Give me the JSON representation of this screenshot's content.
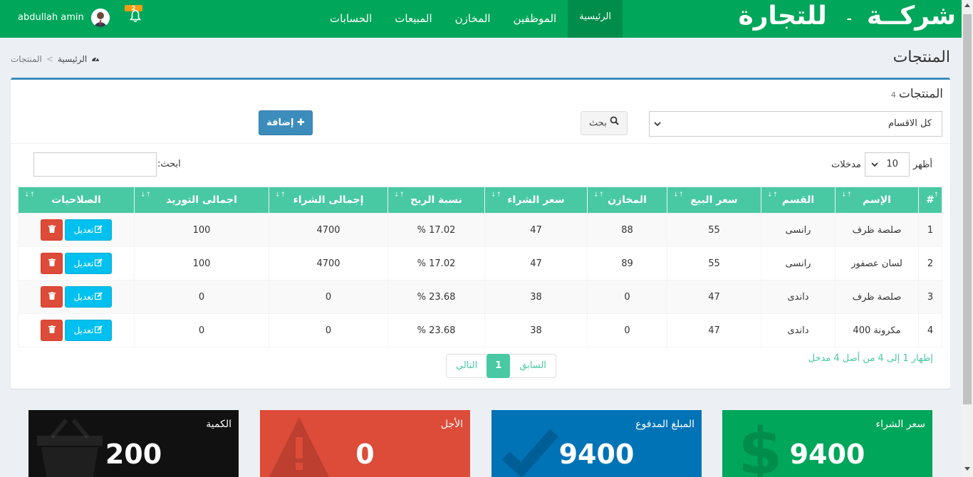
{
  "brand": {
    "name": "شركــة",
    "dash": "ـ",
    "suffix": "للتجارة"
  },
  "nav": {
    "home": "الرئيسية",
    "employees": "الموظفين",
    "stores": "المخازن",
    "sales": "المبيعات",
    "accounts": "الحسابات"
  },
  "user": {
    "name": "abdullah amin",
    "notifications": "2"
  },
  "page": {
    "title": "المنتجات"
  },
  "breadcrumb": {
    "home": "الرئيسية",
    "separator": ">",
    "current": "المنتجات"
  },
  "box": {
    "title": "المنتجات",
    "count": "4"
  },
  "filters": {
    "category_selected": "كل الاقسام",
    "search_button": "بحث",
    "add_button": "إضافة"
  },
  "table_ctrl": {
    "show": "أظهر",
    "length": "10",
    "entries": "مدخلات",
    "search_label": "ابحث:"
  },
  "columns": [
    "#",
    "الإسم",
    "القسم",
    "سعر البيع",
    "المخازن",
    "سعر الشراء",
    "نسبة الربح",
    "إجمالى الشراء",
    "اجمالى التوريد",
    "الصلاحيات"
  ],
  "rows": [
    {
      "num": "1",
      "name": "صلصة ظرف",
      "category": "رانسى",
      "sell": "55",
      "stores": "88",
      "buy": "47",
      "profit": "17.02 %",
      "total_buy": "4700",
      "total_supply": "100"
    },
    {
      "num": "2",
      "name": "لسان عصفور",
      "category": "رانسى",
      "sell": "55",
      "stores": "89",
      "buy": "47",
      "profit": "17.02 %",
      "total_buy": "4700",
      "total_supply": "100"
    },
    {
      "num": "3",
      "name": "صلصة ظرف",
      "category": "داندى",
      "sell": "47",
      "stores": "0",
      "buy": "38",
      "profit": "23.68 %",
      "total_buy": "0",
      "total_supply": "0"
    },
    {
      "num": "4",
      "name": "مكرونة 400",
      "category": "داندى",
      "sell": "47",
      "stores": "0",
      "buy": "38",
      "profit": "23.68 %",
      "total_buy": "0",
      "total_supply": "0"
    }
  ],
  "row_actions": {
    "edit": "تعديل"
  },
  "pagination": {
    "info": "إظهار 1 إلى 4 من أصل 4 مدخل",
    "prev": "السابق",
    "current": "1",
    "next": "التالي"
  },
  "stats": [
    {
      "label": "سعر الشراء",
      "value": "9400",
      "color": "#00a65a",
      "icon": "dollar-icon"
    },
    {
      "label": "المبلغ المدفوع",
      "value": "9400",
      "color": "#0073b7",
      "icon": "check-icon"
    },
    {
      "label": "الأجل",
      "value": "0",
      "color": "#dd4b39",
      "icon": "warning-icon"
    },
    {
      "label": "الكمية",
      "value": "200",
      "color": "#111111",
      "icon": "basket-icon"
    }
  ],
  "colors": {
    "header": "#00a65a",
    "header_active": "#008d4c",
    "table_head": "#48c9a3",
    "box_border": "#3c8dbc"
  }
}
